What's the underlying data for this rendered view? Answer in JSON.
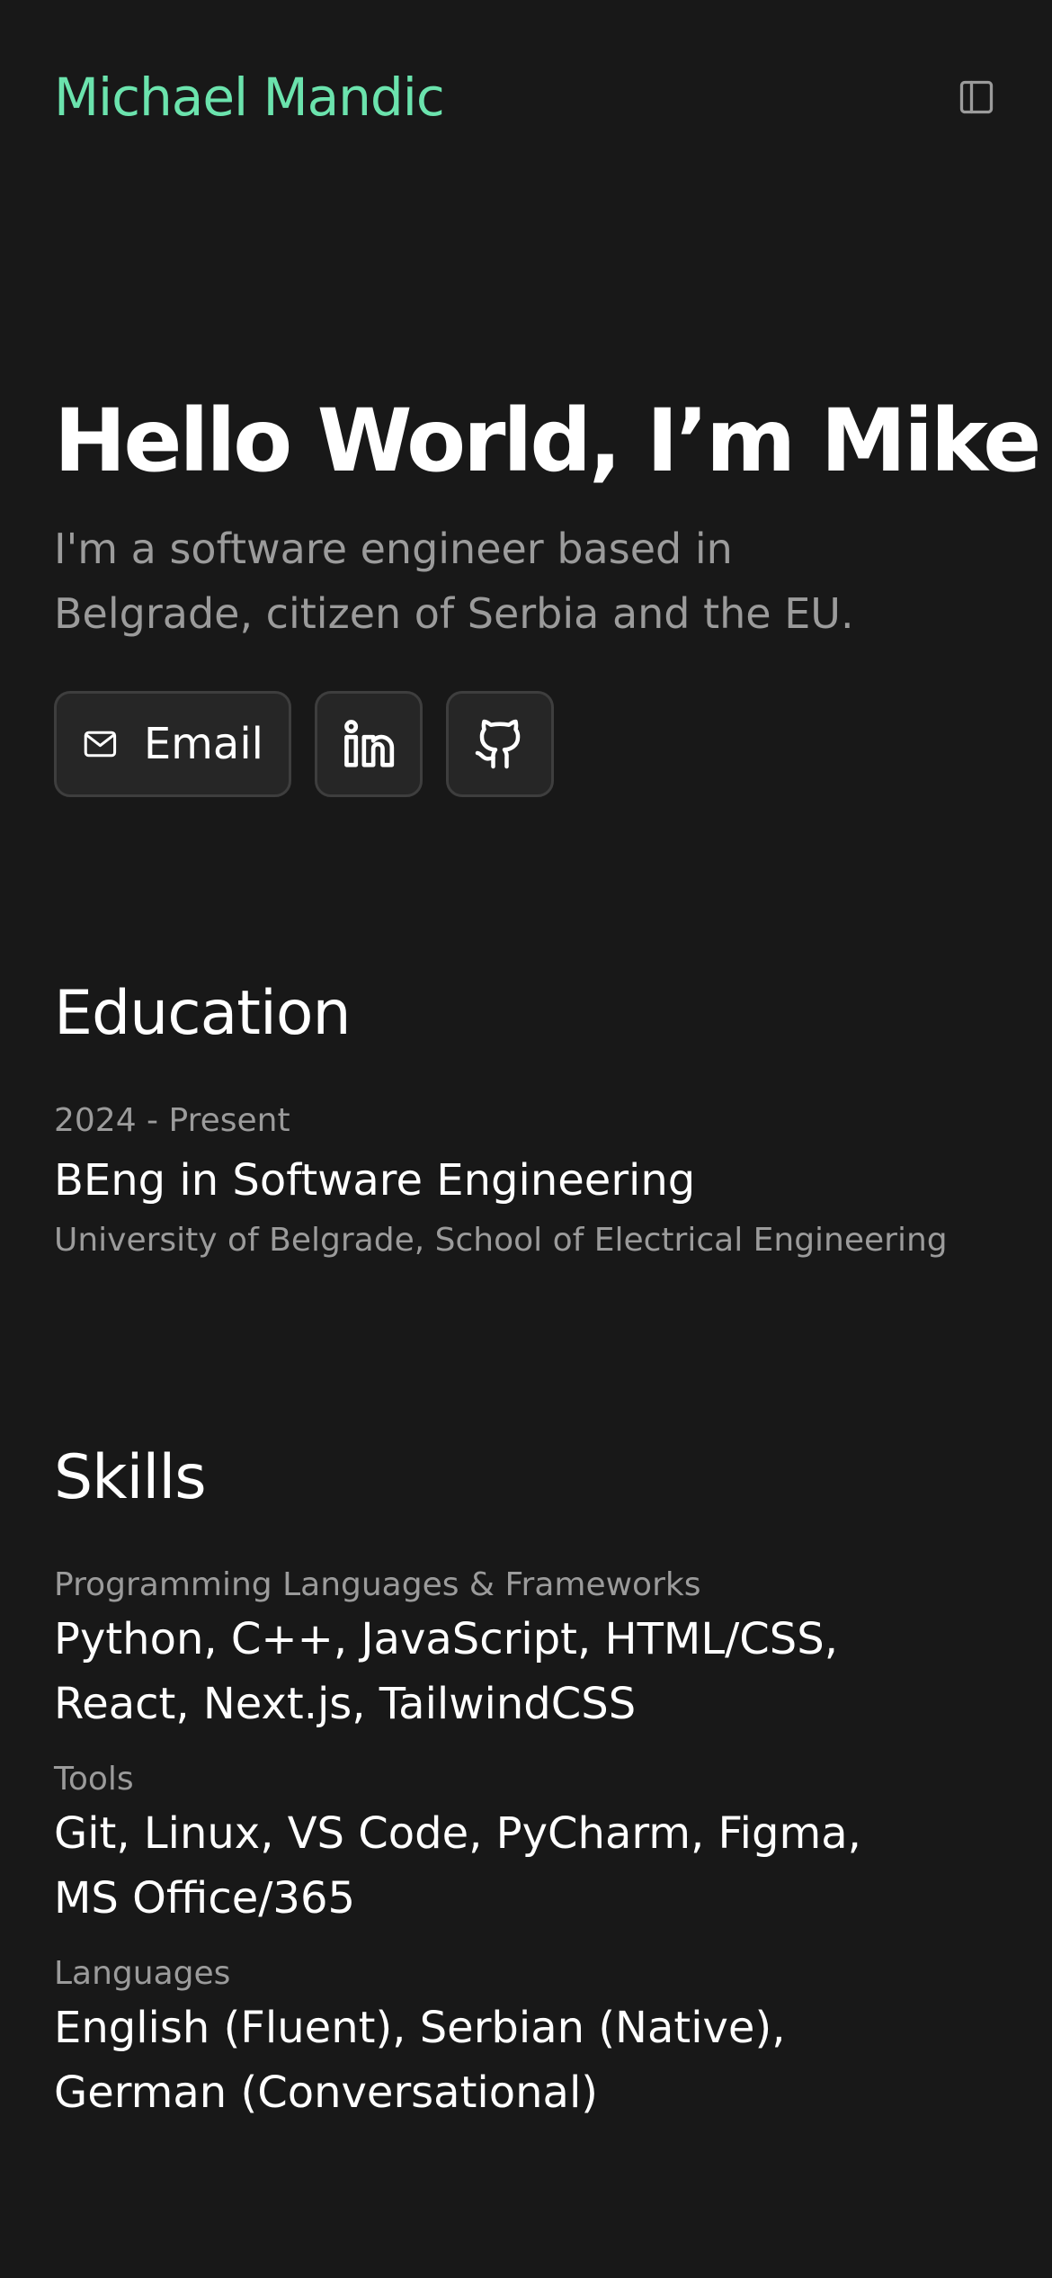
{
  "header": {
    "name": "Michael Mandic",
    "sidebar_toggle_icon": "sidebar-panel-icon"
  },
  "hero": {
    "title": "Hello World, I’m Mike",
    "subtitle": "I'm a software engineer based in Belgrade, citizen of Serbia and the EU.",
    "buttons": [
      {
        "label": "Email",
        "icon": "mail-icon"
      },
      {
        "label": "",
        "icon": "linkedin-icon"
      },
      {
        "label": "",
        "icon": "github-icon"
      }
    ]
  },
  "education": {
    "title": "Education",
    "entries": [
      {
        "period": "2024 - Present",
        "degree": "BEng in Software Engineering",
        "institution": "University of Belgrade, School of Electrical Engineering"
      }
    ]
  },
  "skills": {
    "title": "Skills",
    "groups": [
      {
        "label": "Programming Languages & Frameworks",
        "value": "Python, C++, JavaScript, HTML/CSS, React, Next.js, TailwindCSS"
      },
      {
        "label": "Tools",
        "value": "Git, Linux, VS Code, PyCharm, Figma, MS Office/365"
      },
      {
        "label": "Languages",
        "value": "English (Fluent), Serbian (Native), German (Conversational)"
      }
    ]
  },
  "colors": {
    "background": "#181818",
    "accent": "#6be3ad",
    "muted_text": "#9b9b9b",
    "button_bg": "#262626",
    "button_border": "#3e3e3e"
  }
}
